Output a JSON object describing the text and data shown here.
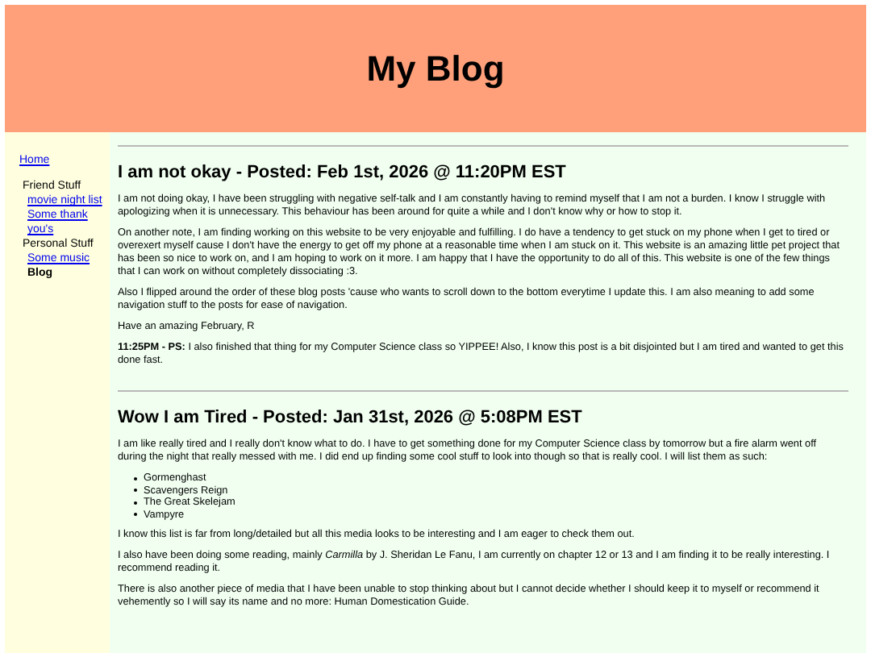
{
  "header": {
    "title": "My Blog"
  },
  "sidebar": {
    "items": [
      {
        "label": "Home",
        "kind": "link",
        "selected": false
      },
      {
        "label": "Friend Stuff",
        "kind": "group",
        "children": [
          {
            "label": "movie night list",
            "selected": false
          },
          {
            "label": "Some thank you's",
            "selected": false
          }
        ]
      },
      {
        "label": "Personal Stuff",
        "kind": "group",
        "children": [
          {
            "label": "Some music",
            "selected": false
          },
          {
            "label": "Blog",
            "selected": true
          }
        ]
      }
    ]
  },
  "posts": [
    {
      "title": "I am not okay - Posted: Feb 1st, 2026 @ 11:20PM EST",
      "blocks": [
        {
          "kind": "paragraph",
          "text": "I am not doing okay, I have been struggling with negative self-talk and I am constantly having to remind myself that I am not a burden. I know I struggle with apologizing when it is unnecessary. This behaviour has been around for quite a while and I don't know why or how to stop it."
        },
        {
          "kind": "paragraph",
          "text": "On another note, I am finding working on this website to be very enjoyable and fulfilling. I do have a tendency to get stuck on my phone when I get to tired or overexert myself cause I don't have the energy to get off my phone at a reasonable time when I am stuck on it. This website is an amazing little pet project that has been so nice to work on, and I am hoping to work on it more. I am happy that I have the opportunity to do all of this. This website is one of the few things that I can work on without completely dissociating :3."
        },
        {
          "kind": "paragraph",
          "text": "Also I flipped around the order of these blog posts 'cause who wants to scroll down to the bottom everytime I update this. I am also meaning to add some navigation stuff to the posts for ease of navigation."
        },
        {
          "kind": "paragraph",
          "text": "Have an amazing February, R"
        },
        {
          "kind": "paragraph",
          "text": "**11:25PM - PS:** I also finished that thing for my Computer Science class so YIPPEE! Also, I know this post is a bit disjointed but I am tired and wanted to get this done fast."
        }
      ]
    },
    {
      "title": "Wow I am Tired - Posted: Jan 31st, 2026 @ 5:08PM EST",
      "blocks": [
        {
          "kind": "paragraph",
          "text": "I am like really tired and I really don't know what to do. I have to get something done for my Computer Science class by tomorrow but a fire alarm went off during the night that really messed with me. I did end up finding some cool stuff to look into though so that is really cool. I will list them as such:"
        },
        {
          "kind": "list",
          "items": [
            "Gormenghast",
            "Scavengers Reign",
            "The Great Skelejam",
            "Vampyre"
          ]
        },
        {
          "kind": "paragraph",
          "text": "I know this list is far from long/detailed but all this media looks to be interesting and I am eager to check them out."
        },
        {
          "kind": "paragraph",
          "text": "I also have been doing some reading, mainly *Carmilla* by J. Sheridan Le Fanu, I am currently on chapter 12 or 13 and I am finding it to be really interesting. I recommend reading it."
        },
        {
          "kind": "paragraph",
          "text": "There is also another piece of media that I have been unable to stop thinking about but I cannot decide whether I should keep it to myself or recommend it vehemently so I will say its name and no more: Human Domestication Guide."
        }
      ]
    }
  ]
}
